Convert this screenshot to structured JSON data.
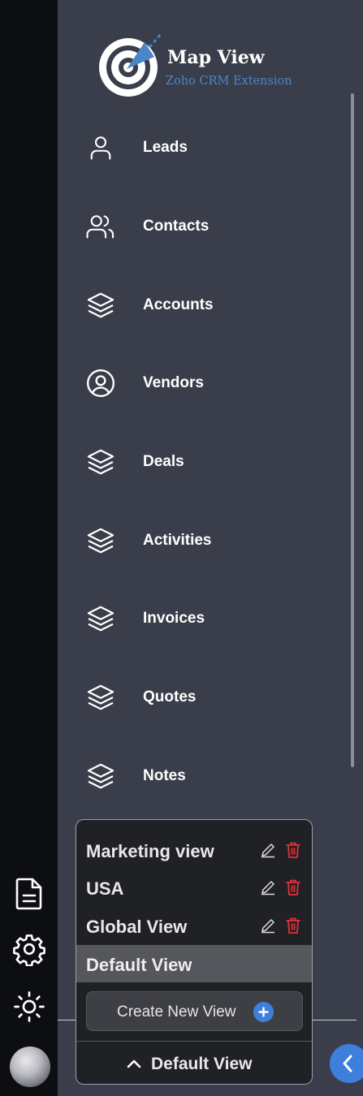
{
  "app": {
    "logo_title": "Map View",
    "logo_subtitle": "Zoho CRM Extension"
  },
  "nav": [
    {
      "label": "Leads",
      "icon": "user-icon"
    },
    {
      "label": "Contacts",
      "icon": "users-icon"
    },
    {
      "label": "Accounts",
      "icon": "layers-icon"
    },
    {
      "label": "Vendors",
      "icon": "user-circle-icon"
    },
    {
      "label": "Deals",
      "icon": "layers-icon"
    },
    {
      "label": "Activities",
      "icon": "layers-icon"
    },
    {
      "label": "Invoices",
      "icon": "layers-icon"
    },
    {
      "label": "Quotes",
      "icon": "layers-icon"
    },
    {
      "label": "Notes",
      "icon": "layers-icon"
    }
  ],
  "views": {
    "items": [
      {
        "label": "Marketing view",
        "editable": true
      },
      {
        "label": "USA",
        "editable": true
      },
      {
        "label": "Global View",
        "editable": true
      },
      {
        "label": "Default View",
        "editable": false,
        "active": true
      }
    ],
    "create_label": "Create New View",
    "current": "Default View"
  },
  "rail": {
    "icons": [
      "document-icon",
      "gear-icon",
      "sun-icon"
    ]
  },
  "colors": {
    "panel": "#3a3e4a",
    "rail": "#0d0e12",
    "accent": "#3f7fdc",
    "delete": "#e0303a"
  }
}
